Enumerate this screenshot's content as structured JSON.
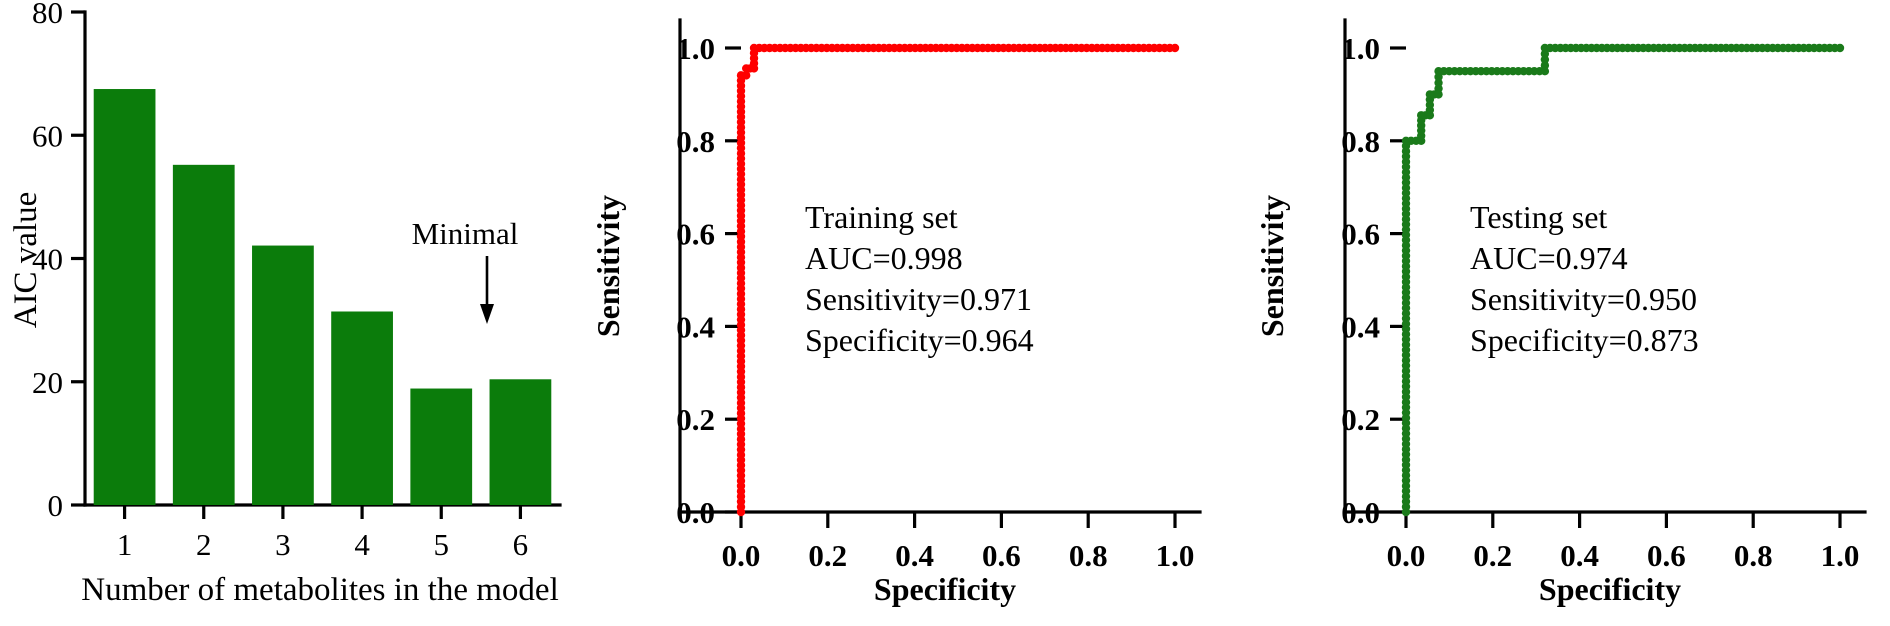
{
  "figure": {
    "panel_count": 3,
    "background": "#ffffff"
  },
  "colors": {
    "bar_green": "#0b7c0b",
    "roc_red": "#ff0000",
    "roc_green": "#1a7a1a",
    "axis_black": "#000000"
  },
  "panel_aic": {
    "ylabel": "AIC value",
    "xlabel": "Number of metabolites in the model",
    "annotation": "Minimal",
    "y_ticks": [
      "0",
      "20",
      "40",
      "60",
      "80"
    ],
    "x_ticks": [
      "1",
      "2",
      "3",
      "4",
      "5",
      "6"
    ]
  },
  "panel_training": {
    "ylabel": "Sensitivity",
    "xlabel": "Specificity",
    "y_ticks": [
      "0.0",
      "0.2",
      "0.4",
      "0.6",
      "0.8",
      "1.0"
    ],
    "x_ticks": [
      "0.0",
      "0.2",
      "0.4",
      "0.6",
      "0.8",
      "1.0"
    ],
    "stats": [
      "Training set",
      "AUC=0.998",
      "Sensitivity=0.971",
      "Specificity=0.964"
    ]
  },
  "panel_testing": {
    "ylabel": "Sensitivity",
    "xlabel": "Specificity",
    "y_ticks": [
      "0.0",
      "0.2",
      "0.4",
      "0.6",
      "0.8",
      "1.0"
    ],
    "x_ticks": [
      "0.0",
      "0.2",
      "0.4",
      "0.6",
      "0.8",
      "1.0"
    ],
    "stats": [
      "Testing set",
      "AUC=0.974",
      "Sensitivity=0.950",
      "Specificity=0.873"
    ]
  },
  "chart_data": [
    {
      "type": "bar",
      "title": "",
      "xlabel": "Number of metabolites in the model",
      "ylabel": "AIC value",
      "categories": [
        "1",
        "2",
        "3",
        "4",
        "5",
        "6"
      ],
      "values": [
        67.5,
        55.2,
        42.1,
        31.4,
        18.9,
        20.4
      ],
      "ylim": [
        0,
        80
      ],
      "yticks": [
        0,
        20,
        40,
        60,
        80
      ],
      "grid": false,
      "legend": "none",
      "annotations": [
        {
          "text": "Minimal",
          "points_to_category": "5",
          "arrow": "down"
        }
      ],
      "series_color": "#0b7c0b"
    },
    {
      "type": "line",
      "subtype": "roc",
      "title": "Training set",
      "xlabel": "Specificity",
      "ylabel": "Sensitivity",
      "xlim": [
        0,
        1
      ],
      "ylim": [
        0,
        1
      ],
      "xticks": [
        0.0,
        0.2,
        0.4,
        0.6,
        0.8,
        1.0
      ],
      "yticks": [
        0.0,
        0.2,
        0.4,
        0.6,
        0.8,
        1.0
      ],
      "grid": false,
      "legend": "none",
      "color": "#ff0000",
      "marker": "circle",
      "metrics": {
        "AUC": 0.998,
        "Sensitivity": 0.971,
        "Specificity": 0.964
      },
      "x": [
        0.0,
        0.0,
        0.012,
        0.012,
        0.03,
        0.03,
        1.0
      ],
      "y": [
        0.0,
        0.941,
        0.941,
        0.956,
        0.956,
        1.0,
        1.0
      ]
    },
    {
      "type": "line",
      "subtype": "roc",
      "title": "Testing set",
      "xlabel": "Specificity",
      "ylabel": "Sensitivity",
      "xlim": [
        0,
        1
      ],
      "ylim": [
        0,
        1
      ],
      "xticks": [
        0.0,
        0.2,
        0.4,
        0.6,
        0.8,
        1.0
      ],
      "yticks": [
        0.0,
        0.2,
        0.4,
        0.6,
        0.8,
        1.0
      ],
      "grid": false,
      "legend": "none",
      "color": "#1a7a1a",
      "marker": "circle",
      "metrics": {
        "AUC": 0.974,
        "Sensitivity": 0.95,
        "Specificity": 0.873
      },
      "x": [
        0.0,
        0.0,
        0.035,
        0.035,
        0.055,
        0.055,
        0.075,
        0.075,
        0.32,
        0.32,
        1.0
      ],
      "y": [
        0.0,
        0.8,
        0.8,
        0.855,
        0.855,
        0.9,
        0.9,
        0.95,
        0.95,
        1.0,
        1.0
      ]
    }
  ]
}
